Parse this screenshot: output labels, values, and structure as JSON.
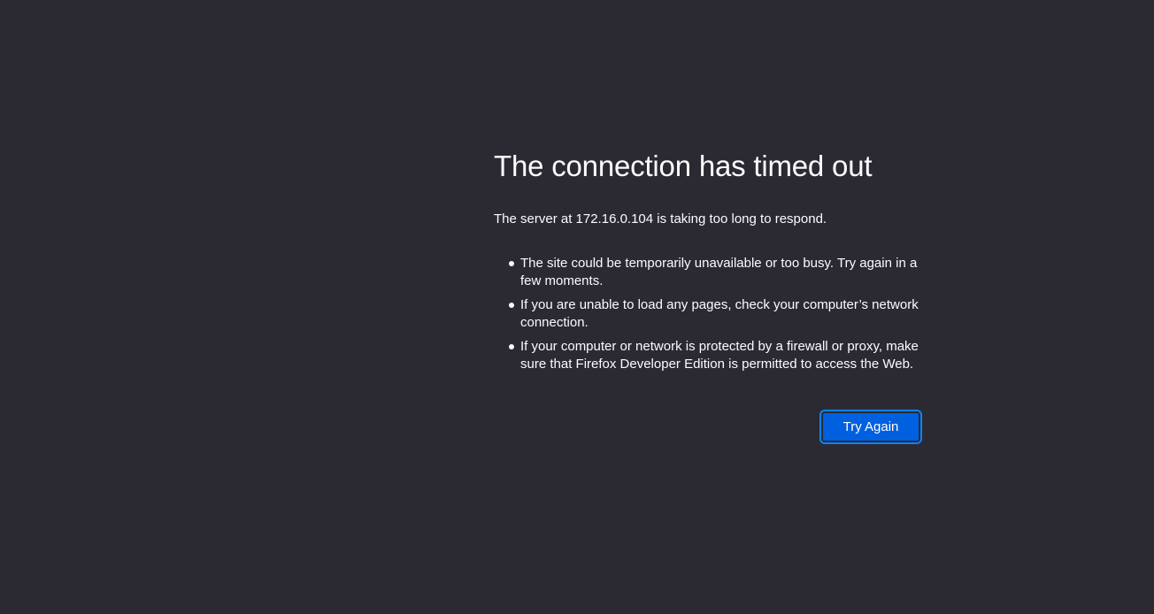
{
  "error": {
    "title": "The connection has timed out",
    "intro": "The server at 172.16.0.104 is taking too long to respond.",
    "suggestions": [
      "The site could be temporarily unavailable or too busy. Try again in a few moments.",
      "If you are unable to load any pages, check your computer’s network connection.",
      "If your computer or network is protected by a firewall or proxy, make sure that Firefox Developer Edition is permitted to access the Web."
    ],
    "try_again_label": "Try Again"
  },
  "colors": {
    "background": "#2b2a33",
    "text": "#fbfbfe",
    "primary_button": "#0060df",
    "focus_ring": "#0a84ff"
  }
}
